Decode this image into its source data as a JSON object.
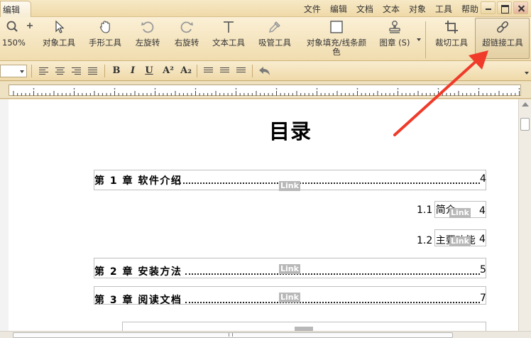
{
  "window": {
    "active_tab": "编辑",
    "menu": [
      "文件",
      "编辑",
      "文档",
      "文本",
      "对象",
      "工具",
      "帮助"
    ],
    "controls": [
      "minimize",
      "maximize",
      "close"
    ]
  },
  "ribbon": {
    "zoom_level": "150%",
    "tools": [
      {
        "label": "对象工具",
        "icon": "cursor-arrow-icon"
      },
      {
        "label": "手形工具",
        "icon": "hand-icon"
      },
      {
        "label": "左旋转",
        "icon": "rotate-left-icon"
      },
      {
        "label": "右旋转",
        "icon": "rotate-right-icon"
      },
      {
        "label": "文本工具",
        "icon": "text-tool-icon"
      },
      {
        "label": "吸管工具",
        "icon": "eyedropper-icon"
      },
      {
        "label": "对象填充/线条颜",
        "label2": "色",
        "icon": "fill-color-icon"
      },
      {
        "label": "图章 (S)",
        "icon": "stamp-icon"
      },
      {
        "label": "裁切工具",
        "icon": "crop-icon"
      },
      {
        "label": "超链接工具",
        "icon": "hyperlink-icon"
      }
    ]
  },
  "format_bar": {
    "buttons": [
      "align-left",
      "align-center",
      "align-right",
      "justify",
      "B",
      "I",
      "U",
      "A²",
      "A₂",
      "list-1",
      "list-2",
      "list-3",
      "undo"
    ],
    "bold": "B",
    "italic": "I",
    "underline": "U",
    "superscript": "A²",
    "subscript": "A₂"
  },
  "document": {
    "title": "目录",
    "link_badge": "Link",
    "toc": [
      {
        "text": "第 1 章  软件介绍",
        "page": "4"
      },
      {
        "text": "1.1 简介",
        "page": "4"
      },
      {
        "text": "1.2 主要功能",
        "page": "4"
      },
      {
        "text": "第 2 章   安装方法",
        "page": "5"
      },
      {
        "text": "第 3 章   阅读文档",
        "page": "7"
      }
    ]
  },
  "colors": {
    "toolbar_bg": "#f0dcae",
    "active_tool_bg": "#e4d0a3",
    "arrow": "#f03a2a",
    "link_badge_bg": "#b8b8b8"
  }
}
